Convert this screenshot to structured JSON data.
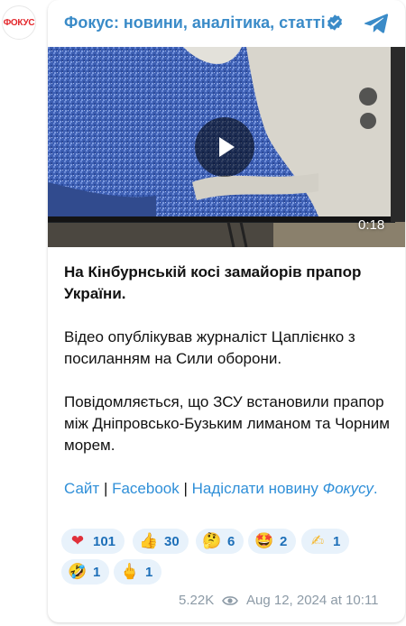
{
  "avatar": {
    "label": "ФОКУС"
  },
  "header": {
    "channel_name": "Фокус: новини, аналітика, статті"
  },
  "video": {
    "duration": "0:18"
  },
  "post": {
    "headline": "На Кінбурнській косі замайорів прапор України.",
    "paragraph1": "Відео опублікував журналіст Цаплієнко з посиланням на Сили оборони.",
    "paragraph2": "Повідомляється, що ЗСУ встановили прапор між Дніпровсько-Бузьким лиманом та Чорним морем.",
    "links": {
      "site": "Сайт",
      "sep1": " | ",
      "facebook": "Facebook",
      "sep2": " | ",
      "send_news": "Надіслати новину",
      "focus": "Фокусу",
      "period": "."
    }
  },
  "reactions": [
    {
      "emoji": "❤",
      "icon": "heart-icon",
      "count": "101",
      "color": "#e0303a"
    },
    {
      "emoji": "👍",
      "icon": "thumbs-up-icon",
      "count": "30",
      "color": "#f5b82e"
    },
    {
      "emoji": "🤔",
      "icon": "thinking-face-icon",
      "count": "6",
      "color": "#f5b82e"
    },
    {
      "emoji": "🤩",
      "icon": "star-struck-icon",
      "count": "2",
      "color": "#f5b82e"
    },
    {
      "emoji": "✍",
      "icon": "writing-hand-icon",
      "count": "1",
      "color": "#f5b82e"
    },
    {
      "emoji": "🤣",
      "icon": "rolling-laughing-icon",
      "count": "1",
      "color": "#f5b82e"
    },
    {
      "emoji": "🖕",
      "icon": "middle-finger-icon",
      "count": "1",
      "color": "#f5b82e"
    }
  ],
  "footer": {
    "views": "5.22K",
    "date": "Aug 12, 2024 at 10:11"
  },
  "colors": {
    "accent": "#3a8bc8",
    "link": "#2f8fd8",
    "reaction_bg": "#e8f2fb",
    "meta": "#8c9aa6"
  }
}
